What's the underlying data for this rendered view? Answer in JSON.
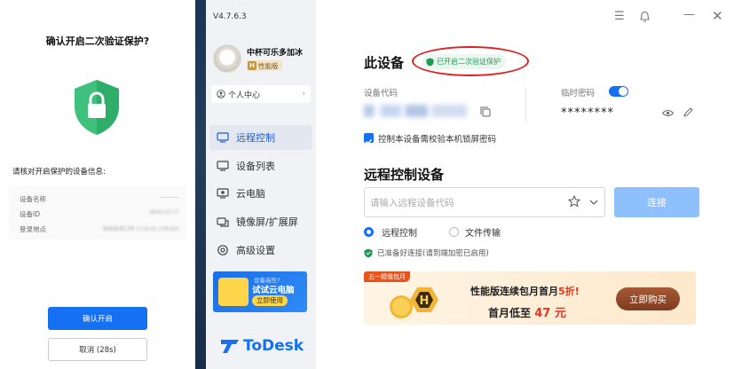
{
  "phone": {
    "title": "确认开启二次验证保护?",
    "subtitle": "请核对开启保护的设备信息:",
    "rows": [
      {
        "label": "设备名称",
        "value": "----------"
      },
      {
        "label": "设备ID",
        "value": "384210177"
      },
      {
        "label": "登录地点",
        "value": "海南省海口市 (119.41.238.85)"
      }
    ],
    "confirm_label": "确认开启",
    "cancel_label": "取消 (28s)"
  },
  "sidebar": {
    "version": "V4.7.6.3",
    "username": "中杯可乐多加冰",
    "badge_letter": "H",
    "badge_text": "性能版",
    "personal_center": "个人中心",
    "nav": [
      {
        "label": "远程控制",
        "icon": "remote-control-icon",
        "active": true
      },
      {
        "label": "设备列表",
        "icon": "device-list-icon",
        "active": false
      },
      {
        "label": "云电脑",
        "icon": "cloud-pc-icon",
        "active": false
      },
      {
        "label": "镜像屏/扩展屏",
        "icon": "mirror-screen-icon",
        "active": false
      },
      {
        "label": "高级设置",
        "icon": "settings-icon",
        "active": false
      }
    ],
    "promo": {
      "line1": "设备高性?",
      "line2": "试试云电脑",
      "cta": "立即使用"
    },
    "logo_text": "ToDesk"
  },
  "main": {
    "this_device": "此设备",
    "verification_badge": "已开启二次验证保护",
    "device_code_label": "设备代码",
    "temp_password_label": "临时密码",
    "temp_password_enabled": true,
    "password_mask": "********",
    "lock_screen_check": "控制本设备需校验本机锁屏密码",
    "lock_screen_checked": true,
    "remote_title": "远程控制设备",
    "remote_input_placeholder": "请输入远程设备代码",
    "connect_label": "连接",
    "mode_options": [
      "远程控制",
      "文件传输"
    ],
    "mode_selected": "远程控制",
    "ready_text": "已准备好连接(请到端加密已启用)",
    "banner": {
      "tag": "五一超值包月",
      "line1_prefix": "性能版连续包月首月",
      "line1_highlight": "5折!",
      "line2_prefix": "首月低至",
      "line2_highlight": "47 元",
      "buy_label": "立即购买"
    }
  },
  "colors": {
    "accent": "#1570f2",
    "success": "#1f9a53",
    "alert_red": "#e02020"
  }
}
